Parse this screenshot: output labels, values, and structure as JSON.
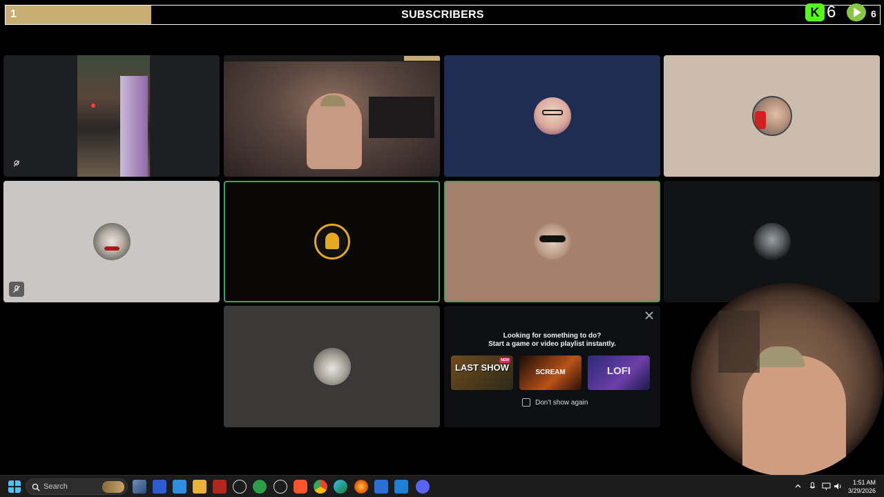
{
  "banner": {
    "count": "1",
    "title": "SUBSCRIBERS",
    "progress_fraction": 0.167,
    "fill_color": "#c8ad72"
  },
  "stats": {
    "kick_count": "6",
    "rumble_count": "6",
    "kick_color": "#53fc18",
    "rumble_color": "#85c742"
  },
  "tiles": [
    {
      "id": "street-video",
      "bg": "#1e1f22"
    },
    {
      "id": "room-video",
      "bg": "#3a3030"
    },
    {
      "id": "glasses-avatar",
      "bg": "#1f2d52"
    },
    {
      "id": "mario-avatar",
      "bg": "#cbbcad"
    },
    {
      "id": "joker-avatar",
      "bg": "#c9c6c4"
    },
    {
      "id": "logo-avatar",
      "bg": "#0a0805"
    },
    {
      "id": "sunglasses-avatar",
      "bg": "#a5806d"
    },
    {
      "id": "car-avatar",
      "bg": "#121314"
    },
    {
      "id": "beard-avatar",
      "bg": "#3a3937"
    }
  ],
  "activity_prompt": {
    "line1": "Looking for something to do?",
    "line2": "Start a game or video playlist instantly.",
    "cards": [
      {
        "title": "LAST SHOW",
        "badge": "NEW"
      },
      {
        "title": "SCREAM"
      },
      {
        "title": "LOFI"
      }
    ],
    "dont_show_label": "Don't show again"
  },
  "taskbar": {
    "search_placeholder": "Search",
    "time": "1:51 AM",
    "date": "3/29/2026"
  }
}
